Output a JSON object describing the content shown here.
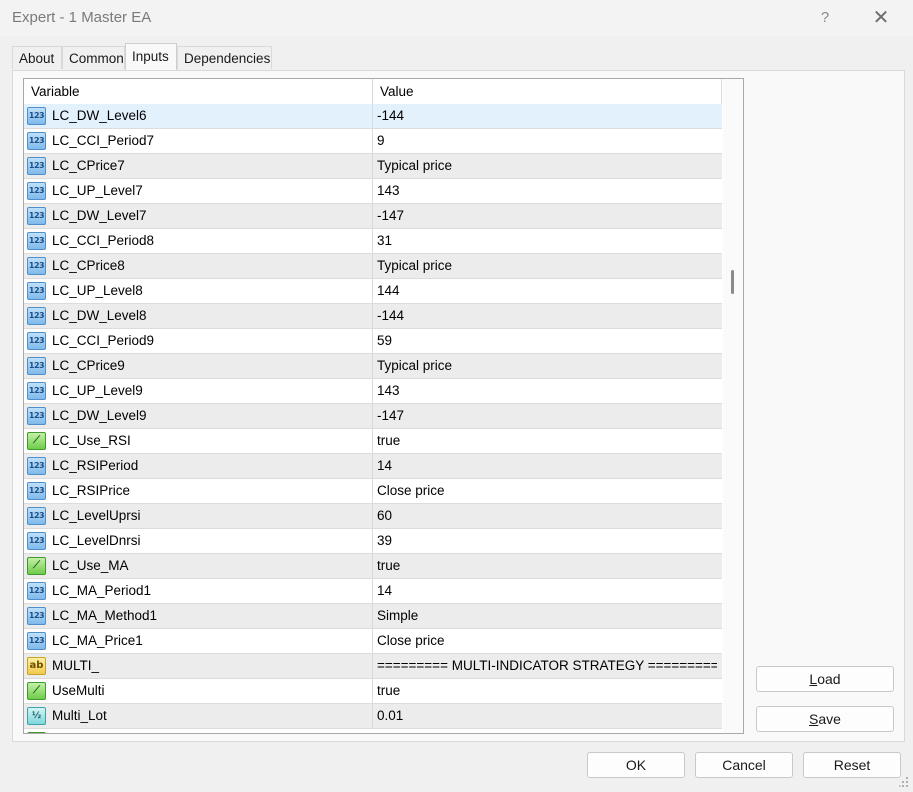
{
  "window": {
    "title": "Expert - 1 Master EA",
    "help_label": "?",
    "close_label": "✕"
  },
  "tabs": [
    {
      "label": "About",
      "active": false
    },
    {
      "label": "Common",
      "active": false
    },
    {
      "label": "Inputs",
      "active": true
    },
    {
      "label": "Dependencies",
      "active": false
    }
  ],
  "grid": {
    "columns": {
      "variable": "Variable",
      "value": "Value"
    },
    "rows": [
      {
        "type": "num",
        "icon": "integer-icon",
        "name": "LC_DW_Level6",
        "value": "-144",
        "selected": true
      },
      {
        "type": "num",
        "icon": "integer-icon",
        "name": "LC_CCI_Period7",
        "value": "9"
      },
      {
        "type": "num",
        "icon": "integer-icon",
        "name": "LC_CPrice7",
        "value": "Typical price"
      },
      {
        "type": "num",
        "icon": "integer-icon",
        "name": "LC_UP_Level7",
        "value": "143"
      },
      {
        "type": "num",
        "icon": "integer-icon",
        "name": "LC_DW_Level7",
        "value": "-147"
      },
      {
        "type": "num",
        "icon": "integer-icon",
        "name": "LC_CCI_Period8",
        "value": "31"
      },
      {
        "type": "num",
        "icon": "integer-icon",
        "name": "LC_CPrice8",
        "value": "Typical price"
      },
      {
        "type": "num",
        "icon": "integer-icon",
        "name": "LC_UP_Level8",
        "value": "144"
      },
      {
        "type": "num",
        "icon": "integer-icon",
        "name": "LC_DW_Level8",
        "value": "-144"
      },
      {
        "type": "num",
        "icon": "integer-icon",
        "name": "LC_CCI_Period9",
        "value": "59"
      },
      {
        "type": "num",
        "icon": "integer-icon",
        "name": "LC_CPrice9",
        "value": "Typical price"
      },
      {
        "type": "num",
        "icon": "integer-icon",
        "name": "LC_UP_Level9",
        "value": "143"
      },
      {
        "type": "num",
        "icon": "integer-icon",
        "name": "LC_DW_Level9",
        "value": "-147"
      },
      {
        "type": "bool",
        "icon": "boolean-icon",
        "name": "LC_Use_RSI",
        "value": "true"
      },
      {
        "type": "num",
        "icon": "integer-icon",
        "name": "LC_RSIPeriod",
        "value": "14"
      },
      {
        "type": "num",
        "icon": "integer-icon",
        "name": "LC_RSIPrice",
        "value": "Close price"
      },
      {
        "type": "num",
        "icon": "integer-icon",
        "name": "LC_LevelUprsi",
        "value": "60"
      },
      {
        "type": "num",
        "icon": "integer-icon",
        "name": "LC_LevelDnrsi",
        "value": "39"
      },
      {
        "type": "bool",
        "icon": "boolean-icon",
        "name": "LC_Use_MA",
        "value": "true"
      },
      {
        "type": "num",
        "icon": "integer-icon",
        "name": "LC_MA_Period1",
        "value": "14"
      },
      {
        "type": "num",
        "icon": "integer-icon",
        "name": "LC_MA_Method1",
        "value": "Simple"
      },
      {
        "type": "num",
        "icon": "integer-icon",
        "name": "LC_MA_Price1",
        "value": "Close price"
      },
      {
        "type": "str",
        "icon": "string-icon",
        "name": "MULTI_",
        "value": "========= MULTI-INDICATOR STRATEGY ========="
      },
      {
        "type": "bool",
        "icon": "boolean-icon",
        "name": "UseMulti",
        "value": "true"
      },
      {
        "type": "dbl",
        "icon": "double-icon",
        "name": "Multi_Lot",
        "value": "0.01"
      }
    ]
  },
  "side_buttons": {
    "load": {
      "underline": "L",
      "rest": "oad"
    },
    "save": {
      "underline": "S",
      "rest": "ave"
    }
  },
  "footer_buttons": {
    "ok": "OK",
    "cancel": "Cancel",
    "reset": "Reset"
  },
  "icon_glyphs": {
    "num": "123",
    "bool": "⟋",
    "str": "ab",
    "dbl": "½"
  },
  "colors": {
    "selected_row": "#e3f1fc",
    "alt_row": "#ececec",
    "accent": "#4f8fca"
  }
}
